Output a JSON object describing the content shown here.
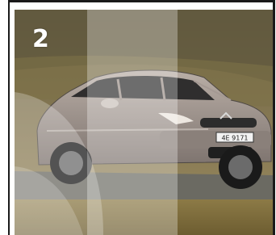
{
  "slide": {
    "number": "2",
    "image_subject": "car-photo"
  },
  "plate": {
    "text": "4E 9171"
  }
}
